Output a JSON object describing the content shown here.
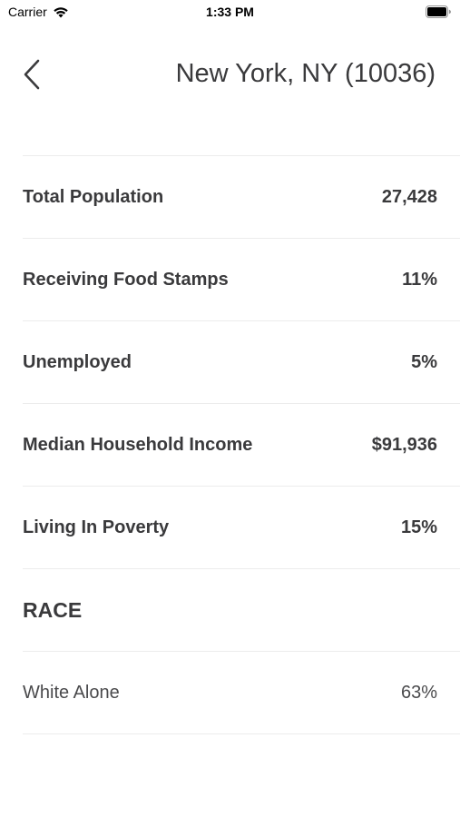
{
  "status_bar": {
    "carrier": "Carrier",
    "time": "1:33 PM"
  },
  "header": {
    "title": "New York, NY (10036)"
  },
  "stats": [
    {
      "label": "Total Population",
      "value": "27,428"
    },
    {
      "label": "Receiving Food Stamps",
      "value": "11%"
    },
    {
      "label": "Unemployed",
      "value": "5%"
    },
    {
      "label": "Median Household Income",
      "value": "$91,936"
    },
    {
      "label": "Living In Poverty",
      "value": "15%"
    }
  ],
  "race": {
    "heading": "RACE",
    "items": [
      {
        "label": "White Alone",
        "value": "63%"
      }
    ]
  },
  "colors": {
    "text": "#3a3a3c",
    "divider": "#ececec"
  },
  "icons": {
    "back": "chevron-left-icon",
    "wifi": "wifi-icon",
    "battery": "battery-icon"
  }
}
